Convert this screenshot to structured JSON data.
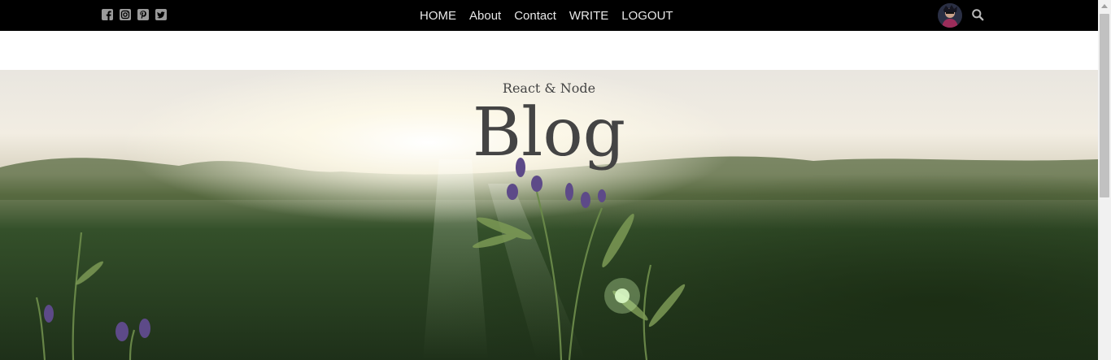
{
  "topbar": {
    "social_icons": [
      "facebook-square-icon",
      "instagram-square-icon",
      "pinterest-square-icon",
      "twitter-square-icon"
    ],
    "nav": {
      "items": [
        {
          "label": "HOME"
        },
        {
          "label": "About"
        },
        {
          "label": "Contact"
        },
        {
          "label": "WRITE"
        },
        {
          "label": "LOGOUT"
        }
      ]
    },
    "right_icons": [
      "avatar",
      "search-icon"
    ]
  },
  "header": {
    "title_small": "React & Node",
    "title_large": "Blog"
  },
  "colors": {
    "topbar_bg": "#000000",
    "nav_text": "#e8e8e8",
    "header_text": "#444444"
  }
}
